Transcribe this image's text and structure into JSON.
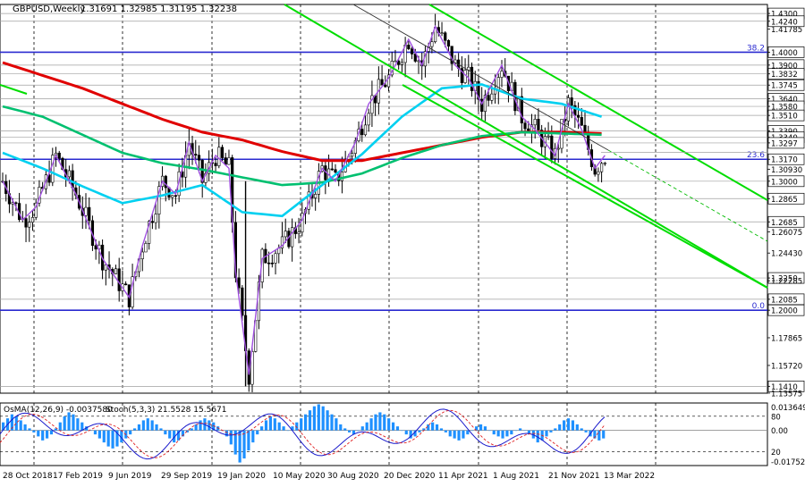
{
  "chart_data": [
    {
      "type": "candlestick",
      "header": {
        "symbol": "GBPUSD,Weekly",
        "ohlc": "1.31691 1.32985 1.31195 1.32238"
      },
      "y_range": [
        1.1357,
        1.437
      ],
      "x_labels": [
        "28 Oct 2018",
        "17 Feb 2019",
        "9 Jun 2019",
        "29 Sep 2019",
        "19 Jan 2020",
        "10 May 2020",
        "30 Aug 2020",
        "20 Dec 2020",
        "11 Apr 2021",
        "1 Aug 2021",
        "21 Nov 2021",
        "13 Mar 2022"
      ],
      "price_labels": [
        {
          "v": 1.43,
          "boxed": true
        },
        {
          "v": 1.424,
          "boxed": true
        },
        {
          "v": 1.41785,
          "boxed": false
        },
        {
          "v": 1.4,
          "boxed": true
        },
        {
          "v": 1.39,
          "boxed": true
        },
        {
          "v": 1.3832,
          "boxed": true
        },
        {
          "v": 1.3745,
          "boxed": true
        },
        {
          "v": 1.364,
          "boxed": true
        },
        {
          "v": 1.358,
          "boxed": true
        },
        {
          "v": 1.351,
          "boxed": true
        },
        {
          "v": 1.339,
          "boxed": true
        },
        {
          "v": 1.334,
          "boxed": true
        },
        {
          "v": 1.3297,
          "boxed": true
        },
        {
          "v": 1.317,
          "boxed": true
        },
        {
          "v": 1.3093,
          "boxed": false
        },
        {
          "v": 1.3,
          "boxed": true
        },
        {
          "v": 1.2865,
          "boxed": true
        },
        {
          "v": 1.2685,
          "boxed": true
        },
        {
          "v": 1.26075,
          "boxed": false
        },
        {
          "v": 1.2443,
          "boxed": false
        },
        {
          "v": 1.225,
          "boxed": true
        },
        {
          "v": 1.22285,
          "boxed": false
        },
        {
          "v": 1.2085,
          "boxed": true
        },
        {
          "v": 1.2,
          "boxed": true
        },
        {
          "v": 1.17865,
          "boxed": false
        },
        {
          "v": 1.1572,
          "boxed": false
        },
        {
          "v": 1.141,
          "boxed": true
        },
        {
          "v": 1.13575,
          "boxed": false
        }
      ],
      "fib_levels": [
        {
          "label": "38.2",
          "value": 1.4
        },
        {
          "label": "23.6",
          "value": 1.317
        },
        {
          "label": "0.0",
          "value": 1.2
        }
      ],
      "series": [
        {
          "name": "EMA200 (red)",
          "color": "#e00000",
          "x": [
            0,
            12,
            24,
            36,
            48,
            60,
            72,
            84,
            96,
            108,
            120,
            132,
            144,
            156,
            168,
            180
          ],
          "values": [
            1.392,
            1.382,
            1.372,
            1.36,
            1.348,
            1.338,
            1.332,
            1.323,
            1.316,
            1.316,
            1.322,
            1.328,
            1.334,
            1.338,
            1.338,
            1.337
          ]
        },
        {
          "name": "EMA144 (green)",
          "color": "#00c070",
          "x": [
            0,
            12,
            24,
            36,
            48,
            60,
            72,
            84,
            96,
            108,
            120,
            132,
            144,
            156,
            168,
            180
          ],
          "values": [
            1.358,
            1.35,
            1.336,
            1.322,
            1.314,
            1.309,
            1.303,
            1.297,
            1.299,
            1.306,
            1.318,
            1.328,
            1.335,
            1.338,
            1.337,
            1.336
          ]
        },
        {
          "name": "EMA50 (cyan)",
          "color": "#00d0f0",
          "x": [
            0,
            12,
            24,
            36,
            48,
            60,
            72,
            84,
            96,
            108,
            120,
            132,
            144,
            156,
            168,
            180
          ],
          "values": [
            1.322,
            1.31,
            1.296,
            1.283,
            1.289,
            1.297,
            1.276,
            1.273,
            1.297,
            1.321,
            1.35,
            1.372,
            1.375,
            1.364,
            1.36,
            1.35
          ]
        }
      ],
      "ohlc_weeks": 182,
      "channel_lines": [
        {
          "color": "#00dd00",
          "from": [
            1.437,
            83
          ],
          "to": [
            1.224,
            193
          ]
        },
        {
          "color": "#00dd00",
          "from": [
            1.437,
            119
          ],
          "to": [
            1.288,
            193
          ]
        },
        {
          "color": "#00dd00",
          "from": [
            1.382,
            141
          ],
          "to": [
            1.298,
            193
          ]
        }
      ],
      "osma_label": "OsMA(12,26,9) -0.0037580",
      "stoch_label": "Stoch(5,3,3) 21.5528 15.5671",
      "osma_range": [
        -0.017524,
        0.013649
      ],
      "osma_axis_labels": [
        "0.013649",
        "0.00",
        "-0.017524"
      ],
      "stoch_levels": [
        80,
        20
      ],
      "osma_values": [
        0.004,
        0.006,
        0.008,
        0.007,
        0.005,
        0.003,
        0.001,
        -0.001,
        -0.003,
        -0.005,
        -0.004,
        -0.002,
        0.001,
        0.004,
        0.007,
        0.009,
        0.008,
        0.006,
        0.004,
        0.002,
        0.0,
        -0.002,
        -0.004,
        -0.006,
        -0.008,
        -0.009,
        -0.008,
        -0.006,
        -0.004,
        -0.002,
        0.001,
        0.003,
        0.005,
        0.006,
        0.005,
        0.003,
        0.001,
        -0.002,
        -0.004,
        -0.006,
        -0.005,
        -0.003,
        -0.001,
        0.001,
        0.003,
        0.005,
        0.006,
        0.005,
        0.004,
        0.002,
        0.0,
        -0.003,
        -0.007,
        -0.012,
        -0.016,
        -0.014,
        -0.01,
        -0.006,
        -0.002,
        0.002,
        0.005,
        0.007,
        0.006,
        0.004,
        0.002,
        0.0,
        0.002,
        0.004,
        0.006,
        0.008,
        0.01,
        0.012,
        0.013,
        0.012,
        0.01,
        0.008,
        0.006,
        0.003,
        0.001,
        -0.001,
        -0.002,
        0.0,
        0.002,
        0.004,
        0.006,
        0.008,
        0.009,
        0.008,
        0.006,
        0.004,
        0.002,
        0.0,
        -0.002,
        -0.004,
        -0.003,
        -0.001,
        0.001,
        0.003,
        0.004,
        0.003,
        0.001,
        -0.001,
        -0.003,
        -0.004,
        -0.005,
        -0.004,
        -0.002,
        0.0,
        0.002,
        0.003,
        0.002,
        0.0,
        -0.002,
        -0.003,
        -0.004,
        -0.003,
        -0.002,
        0.0,
        0.001,
        0.0,
        -0.002,
        -0.004,
        -0.006,
        -0.005,
        -0.003,
        -0.001,
        0.001,
        0.003,
        0.005,
        0.006,
        0.005,
        0.003,
        0.001,
        -0.001,
        -0.003,
        -0.004,
        -0.005,
        -0.004
      ]
    }
  ]
}
